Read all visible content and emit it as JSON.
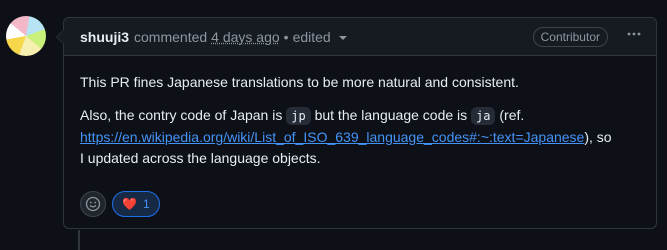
{
  "comment": {
    "author": "shuuji3",
    "action": "commented",
    "time": "4 days ago",
    "separator": "•",
    "edited": "edited",
    "role_badge": "Contributor",
    "more_icon": "kebab-horizontal-icon"
  },
  "body": {
    "p1": "This PR fines Japanese translations to be more natural and consistent.",
    "p2_a": "Also, the contry code of Japan is ",
    "p2_code1": "jp",
    "p2_b": " but the language code is ",
    "p2_code2": "ja",
    "p2_c": " (ref.",
    "link": "https://en.wikipedia.org/wiki/List_of_ISO_639_language_codes#:~:text=Japanese",
    "p2_d": "), so",
    "p2_e": "I updated across the language objects."
  },
  "reactions": {
    "add_icon": "smiley-icon",
    "heart_emoji": "❤️",
    "heart_count": "1"
  }
}
